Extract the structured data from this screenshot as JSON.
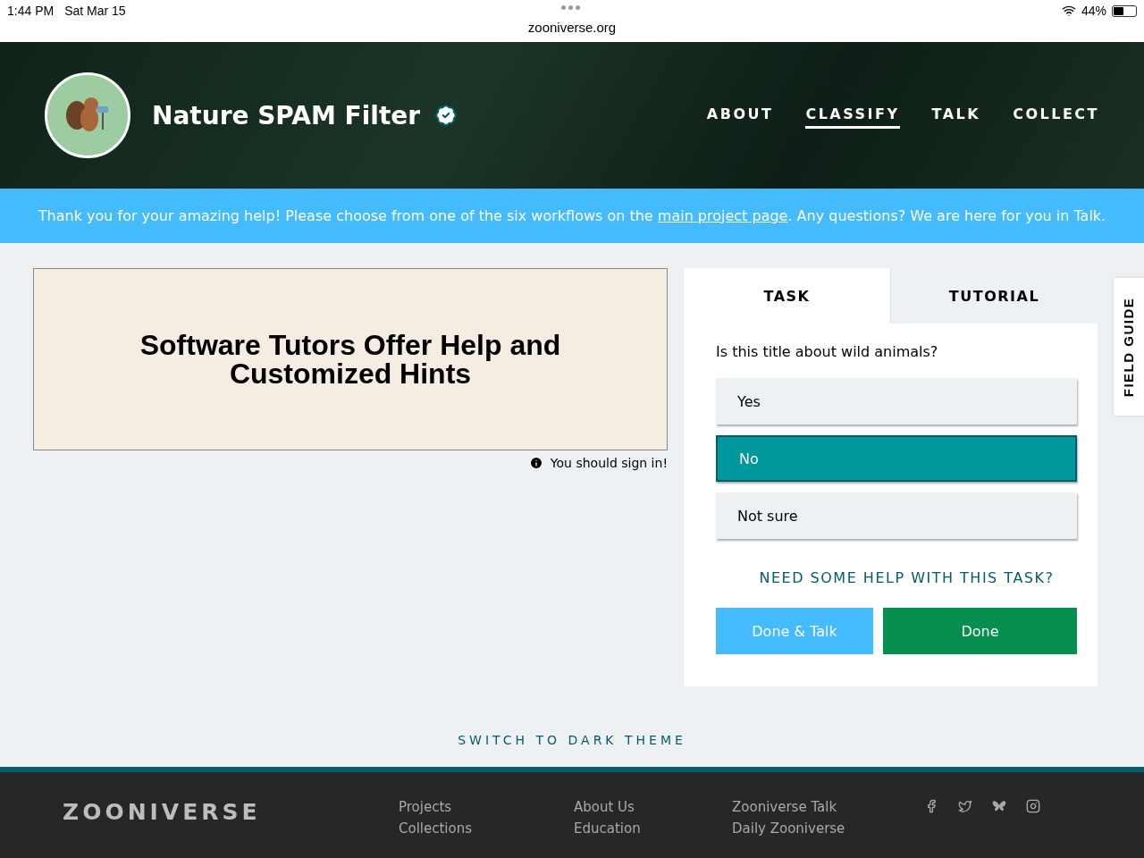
{
  "status_bar": {
    "time": "1:44 PM",
    "date": "Sat Mar 15",
    "url": "zooniverse.org",
    "battery": "44%"
  },
  "header": {
    "title": "Nature SPAM Filter",
    "verified": true,
    "nav": [
      {
        "label": "ABOUT",
        "selected": false
      },
      {
        "label": "CLASSIFY",
        "selected": true
      },
      {
        "label": "TALK",
        "selected": false
      },
      {
        "label": "COLLECT",
        "selected": false
      }
    ]
  },
  "banner": {
    "before": "Thank you for your amazing help! Please choose from one of the six workflows on the ",
    "link": "main project page",
    "after": ". Any questions? We are here for you in Talk."
  },
  "subject": {
    "text": "Software Tutors Offer Help and Customized Hints",
    "sign_in": "You should sign in!"
  },
  "task_panel": {
    "tabs": [
      {
        "label": "TASK",
        "selected": true
      },
      {
        "label": "TUTORIAL",
        "selected": false
      }
    ],
    "question": "Is this title about wild animals?",
    "answers": [
      {
        "label": "Yes",
        "selected": false
      },
      {
        "label": "No",
        "selected": true
      },
      {
        "label": "Not sure",
        "selected": false
      }
    ],
    "help": "NEED SOME HELP WITH THIS TASK?",
    "buttons": [
      {
        "kind": "talk",
        "label": "Done & Talk"
      },
      {
        "kind": "done",
        "label": "Done"
      }
    ]
  },
  "field_guide": "FIELD GUIDE",
  "theme_switch": "SWITCH TO DARK THEME",
  "footer": {
    "logo": "ZOONIVERSE",
    "columns": [
      [
        "Projects",
        "Collections"
      ],
      [
        "About Us",
        "Education"
      ],
      [
        "Zooniverse Talk",
        "Daily Zooniverse"
      ]
    ]
  }
}
